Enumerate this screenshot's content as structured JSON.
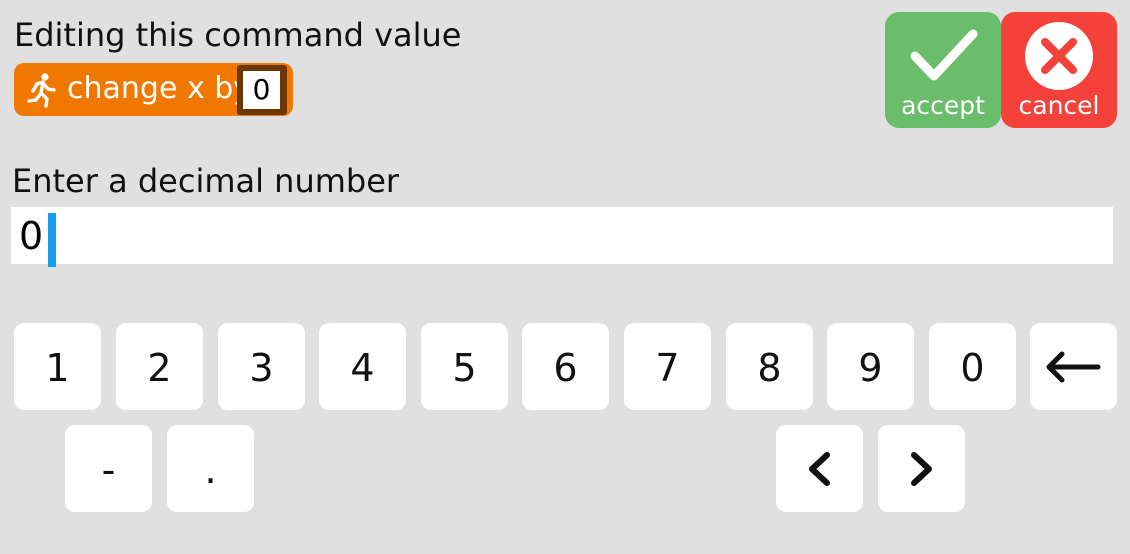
{
  "header": {
    "title": "Editing this command value"
  },
  "command_block": {
    "icon": "running-person-icon",
    "label": "change x by",
    "value": "0",
    "color": "#f07800"
  },
  "actions": {
    "accept_label": "accept",
    "cancel_label": "cancel",
    "accept_icon": "checkmark-icon",
    "cancel_icon": "close-circle-icon",
    "accept_color": "#6abd6a",
    "cancel_color": "#f4423a"
  },
  "input": {
    "prompt": "Enter a decimal number",
    "value": "0",
    "caret_color": "#1a9cf0"
  },
  "keypad": {
    "digits": [
      "1",
      "2",
      "3",
      "4",
      "5",
      "6",
      "7",
      "8",
      "9",
      "0"
    ],
    "backspace_icon": "backspace-arrow-icon",
    "minus": "-",
    "decimal": ".",
    "cursor_left_icon": "chevron-left-icon",
    "cursor_right_icon": "chevron-right-icon"
  }
}
